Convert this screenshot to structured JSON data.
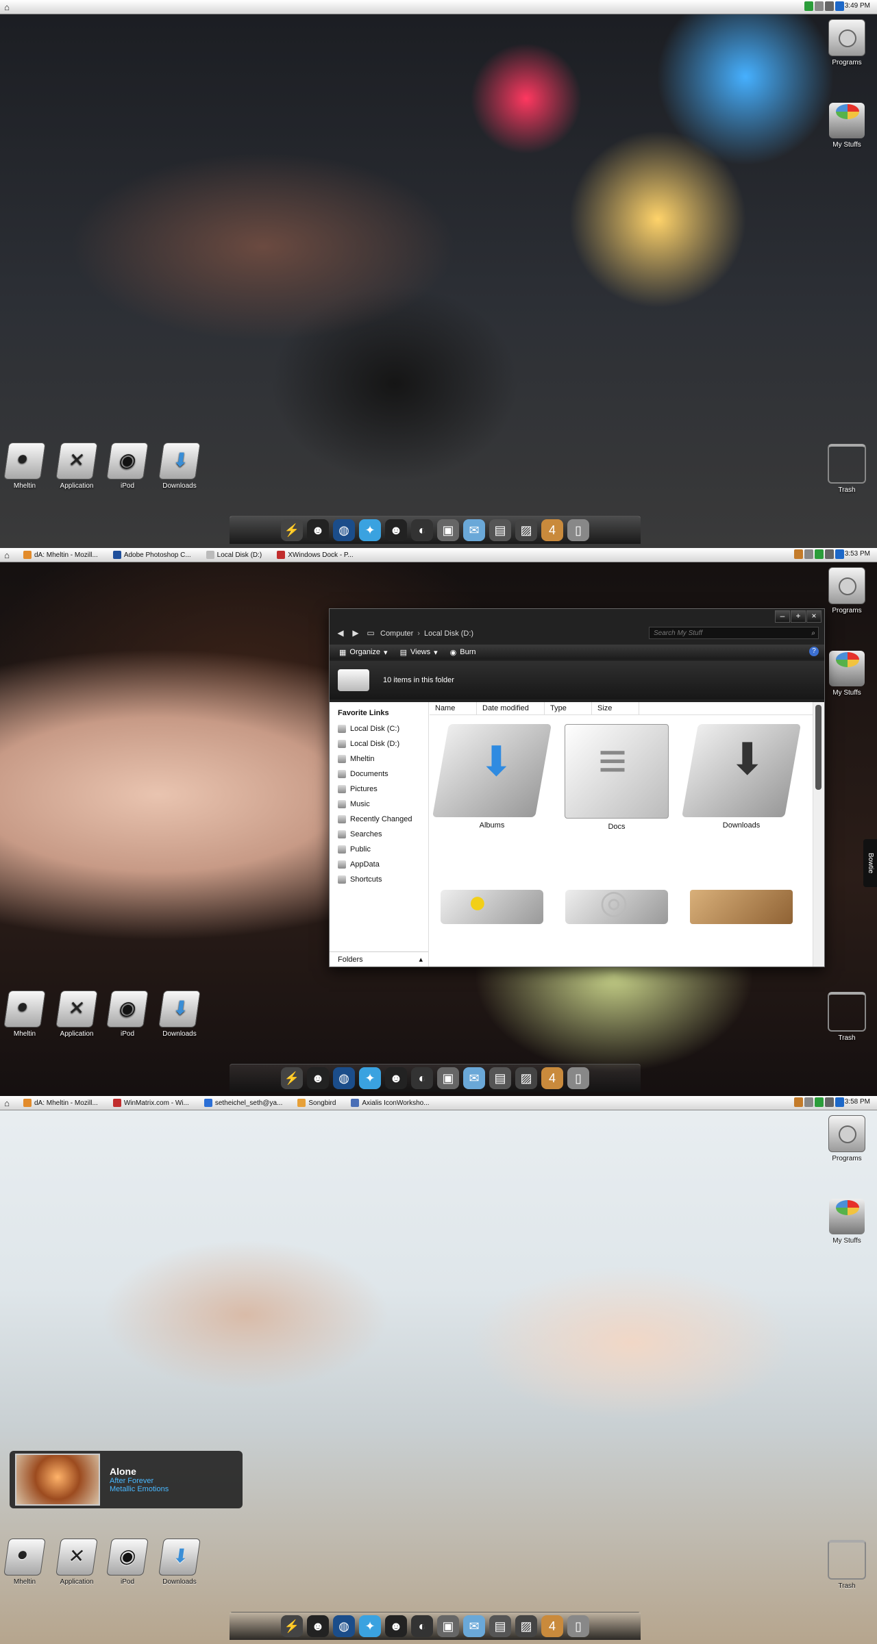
{
  "screens": [
    {
      "clock": "3:49 PM",
      "taskbar": [],
      "left_icons": [
        "Mheltin",
        "Application",
        "iPod",
        "Downloads"
      ],
      "right_icons": [
        "Programs",
        "My Stuffs",
        "Trash"
      ]
    },
    {
      "clock": "3:53 PM",
      "taskbar": [
        "dA: Mheltin - Mozill...",
        "Adobe Photoshop C...",
        "Local Disk (D:)",
        "XWindows Dock - P..."
      ],
      "left_icons": [
        "Mheltin",
        "Application",
        "iPod",
        "Downloads"
      ],
      "right_icons": [
        "Programs",
        "My Stuffs",
        "Trash"
      ],
      "side_tab": "Bowtie"
    },
    {
      "clock": "3:58 PM",
      "taskbar": [
        "dA: Mheltin - Mozill...",
        "WinMatrix.com - Wi...",
        "setheichel_seth@ya...",
        "Songbird",
        "Axialis IconWorksho..."
      ],
      "left_icons": [
        "Mheltin",
        "Application",
        "iPod",
        "Downloads"
      ],
      "right_icons": [
        "Programs",
        "My Stuffs",
        "Trash"
      ]
    }
  ],
  "explorer": {
    "breadcrumb": [
      "Computer",
      "Local Disk (D:)"
    ],
    "search_placeholder": "Search My Stuff",
    "toolbar": [
      "Organize",
      "Views",
      "Burn"
    ],
    "item_count": "10 items in this folder",
    "favorites_title": "Favorite Links",
    "favorites": [
      "Local Disk (C:)",
      "Local Disk (D:)",
      "Mheltin",
      "Documents",
      "Pictures",
      "Music",
      "Recently Changed",
      "Searches",
      "Public",
      "AppData",
      "Shortcuts"
    ],
    "folders_label": "Folders",
    "columns": [
      "Name",
      "Date modified",
      "Type",
      "Size"
    ],
    "files": [
      "Albums",
      "Docs",
      "Downloads",
      "",
      "",
      ""
    ]
  },
  "player": {
    "title": "Alone",
    "artist": "After Forever",
    "album": "Metallic Emotions"
  }
}
